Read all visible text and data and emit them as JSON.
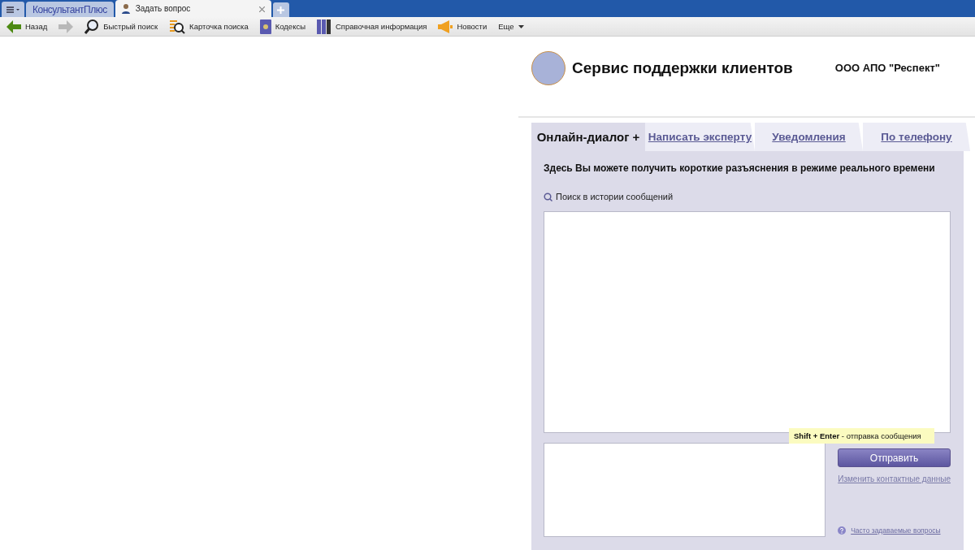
{
  "browser_tabs": [
    {
      "label": "КонсультантПлюс",
      "selected": false,
      "kind": "brand"
    },
    {
      "label": "Задать вопрос",
      "selected": true,
      "kind": "page"
    }
  ],
  "toolbar": [
    {
      "label": "Назад",
      "kind": "back"
    },
    {
      "kind": "forward"
    },
    {
      "label": "Быстрый поиск",
      "kind": "search"
    },
    {
      "label": "Карточка поиска",
      "kind": "card"
    },
    {
      "label": "Кодексы",
      "kind": "codes"
    },
    {
      "label": "Справочная информация",
      "kind": "reference"
    },
    {
      "label": "Новости",
      "kind": "news"
    },
    {
      "label": "Еще",
      "kind": "more"
    }
  ],
  "header": {
    "title": "Сервис поддержки клиентов",
    "company": "ООО АПО \"Респект\""
  },
  "tabs": [
    {
      "label": "Онлайн-диалог +",
      "selected": true
    },
    {
      "label": "Написать эксперту",
      "selected": false
    },
    {
      "label": "Уведомления",
      "selected": false
    },
    {
      "label": "По телефону",
      "selected": false
    }
  ],
  "intro": "Здесь Вы можете получить короткие разъяснения в режиме реального времени",
  "history_search": "Поиск в истории сообщений",
  "tooltip": "**Shift + Enter** - отправка сообщения",
  "send_button": "Отправить",
  "contact_link": "Изменить контактные данные",
  "faq_link": "Часто задаваемые вопросы"
}
